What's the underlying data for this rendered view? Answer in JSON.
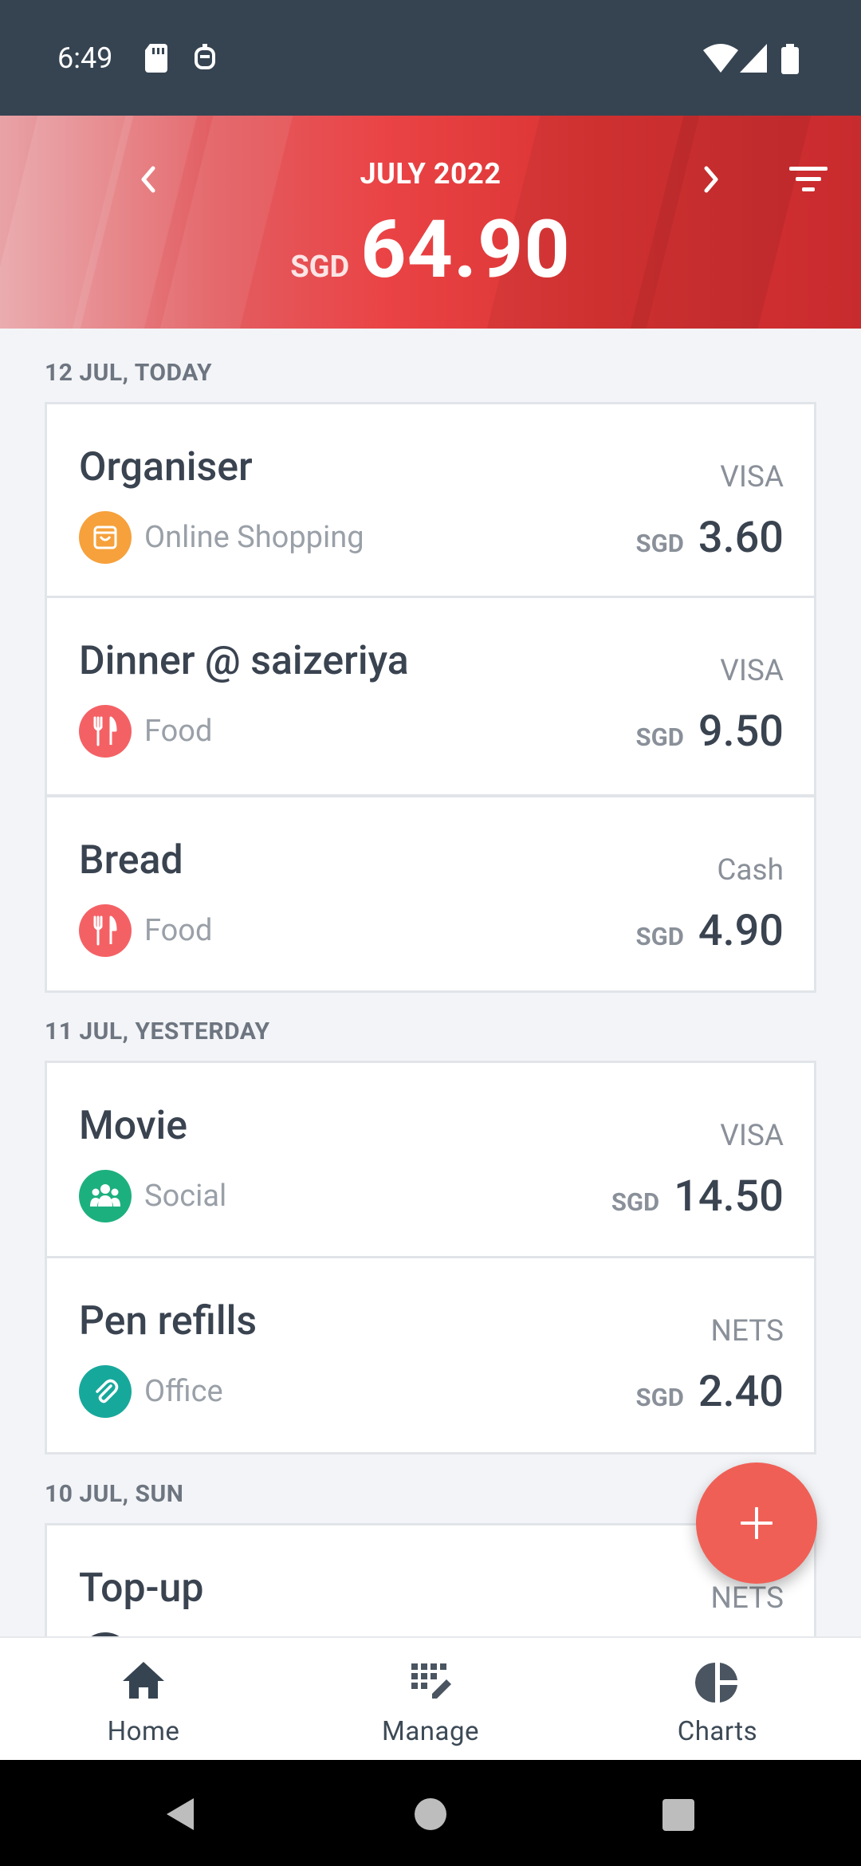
{
  "status_bar": {
    "time": "6:49"
  },
  "header": {
    "month": "JULY 2022",
    "currency": "SGD",
    "total": "64.90"
  },
  "groups": [
    {
      "label": "12 JUL, TODAY",
      "transactions": [
        {
          "title": "Organiser",
          "account": "VISA",
          "category": "Online Shopping",
          "category_icon": "shopping-bag-icon",
          "category_color": "#f6a13c",
          "currency": "SGD",
          "amount": "3.60"
        },
        {
          "title": "Dinner @ saizeriya",
          "account": "VISA",
          "category": "Food",
          "category_icon": "utensils-icon",
          "category_color": "#f46165",
          "currency": "SGD",
          "amount": "9.50"
        },
        {
          "title": "Bread",
          "account": "Cash",
          "category": "Food",
          "category_icon": "utensils-icon",
          "category_color": "#f46165",
          "currency": "SGD",
          "amount": "4.90"
        }
      ]
    },
    {
      "label": "11 JUL, YESTERDAY",
      "transactions": [
        {
          "title": "Movie",
          "account": "VISA",
          "category": "Social",
          "category_icon": "people-icon",
          "category_color": "#1db07f",
          "currency": "SGD",
          "amount": "14.50"
        },
        {
          "title": "Pen refills",
          "account": "NETS",
          "category": "Office",
          "category_icon": "paperclip-icon",
          "category_color": "#17a89c",
          "currency": "SGD",
          "amount": "2.40"
        }
      ]
    },
    {
      "label": "10 JUL, SUN",
      "transactions": [
        {
          "title": "Top-up",
          "account": "NETS"
        }
      ]
    }
  ],
  "bottom_nav": [
    {
      "label": "Home",
      "icon": "home-icon"
    },
    {
      "label": "Manage",
      "icon": "manage-icon"
    },
    {
      "label": "Charts",
      "icon": "pie-chart-icon"
    }
  ],
  "colors": {
    "status_bar": "#364452",
    "accent_red": "#ea4345",
    "fab": "#f05f55"
  }
}
